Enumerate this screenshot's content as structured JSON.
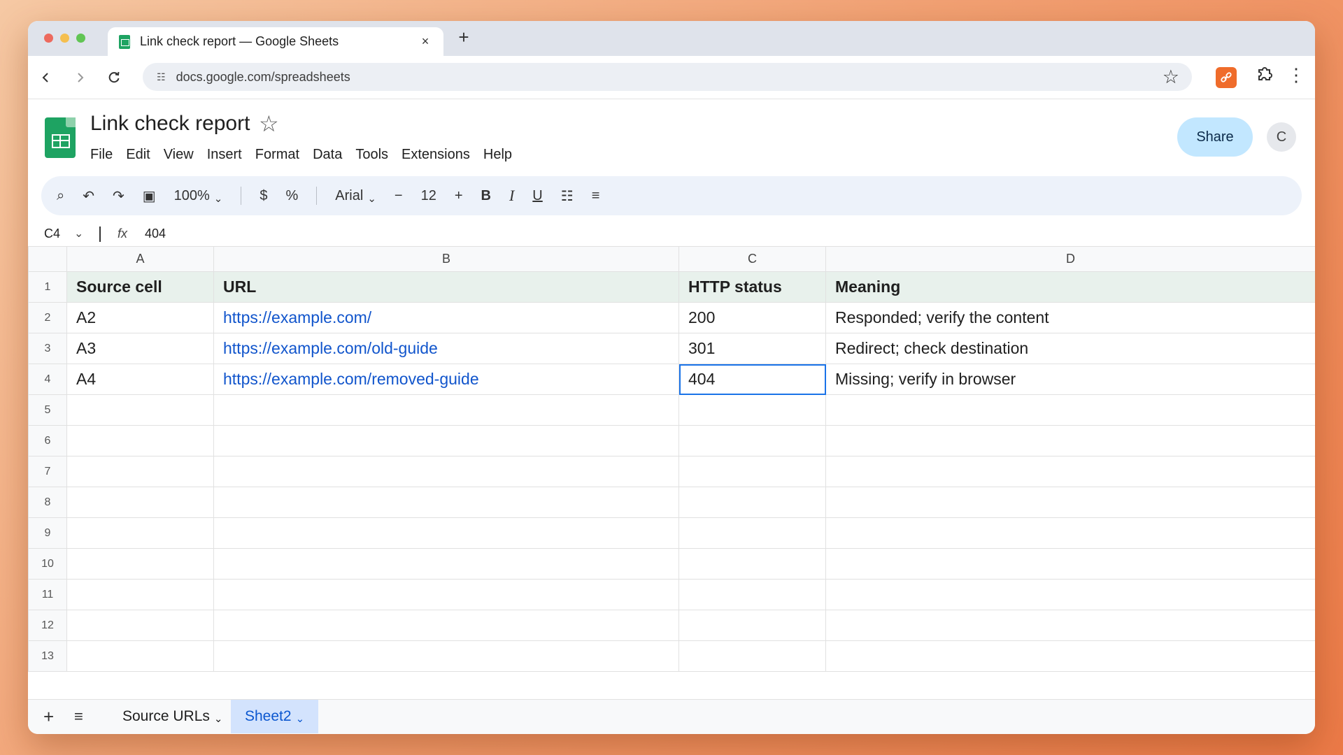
{
  "browser": {
    "tab_title": "Link check report — Google Sheets",
    "tab_close": "×",
    "new_tab": "+",
    "url": "docs.google.com/spreadsheets",
    "traffic_colors": [
      "#ed6a5e",
      "#f5bf4f",
      "#61c554"
    ]
  },
  "doc": {
    "title": "Link check report",
    "menu": [
      "File",
      "Edit",
      "View",
      "Insert",
      "Format",
      "Data",
      "Tools",
      "Extensions",
      "Help"
    ],
    "share_label": "Share",
    "avatar_initial": "C"
  },
  "toolbar": {
    "zoom": "100%",
    "currency": "$",
    "percent": "%",
    "font": "Arial",
    "minus": "−",
    "font_size": "12",
    "plus": "+",
    "bold": "B",
    "italic": "I",
    "underline": "U"
  },
  "formula_bar": {
    "cell_ref": "C4",
    "fx": "fx",
    "value": "404"
  },
  "sheet": {
    "columns": [
      "A",
      "B",
      "C",
      "D"
    ],
    "row_numbers": [
      "1",
      "2",
      "3",
      "4",
      "5",
      "6",
      "7",
      "8",
      "9",
      "10",
      "11",
      "12",
      "13"
    ],
    "header": [
      "Source cell",
      "URL",
      "HTTP status",
      "Meaning"
    ],
    "rows": [
      [
        "A2",
        "https://example.com/",
        "200",
        "Responded; verify the content"
      ],
      [
        "A3",
        "https://example.com/old-guide",
        "301",
        "Redirect; check destination"
      ],
      [
        "A4",
        "https://example.com/removed-guide",
        "404",
        "Missing; verify in browser"
      ]
    ],
    "selected_cell": "C4"
  },
  "sheet_tabs": {
    "add": "+",
    "all": "≡",
    "tabs": [
      "Source URLs",
      "Sheet2"
    ],
    "active": "Sheet2"
  },
  "colors": {
    "header_fill": "#e8f1ec",
    "link": "#1155cc",
    "selection": "#1a73e8",
    "share_bg": "#c2e7ff",
    "sheets_green": "#1ea362"
  }
}
